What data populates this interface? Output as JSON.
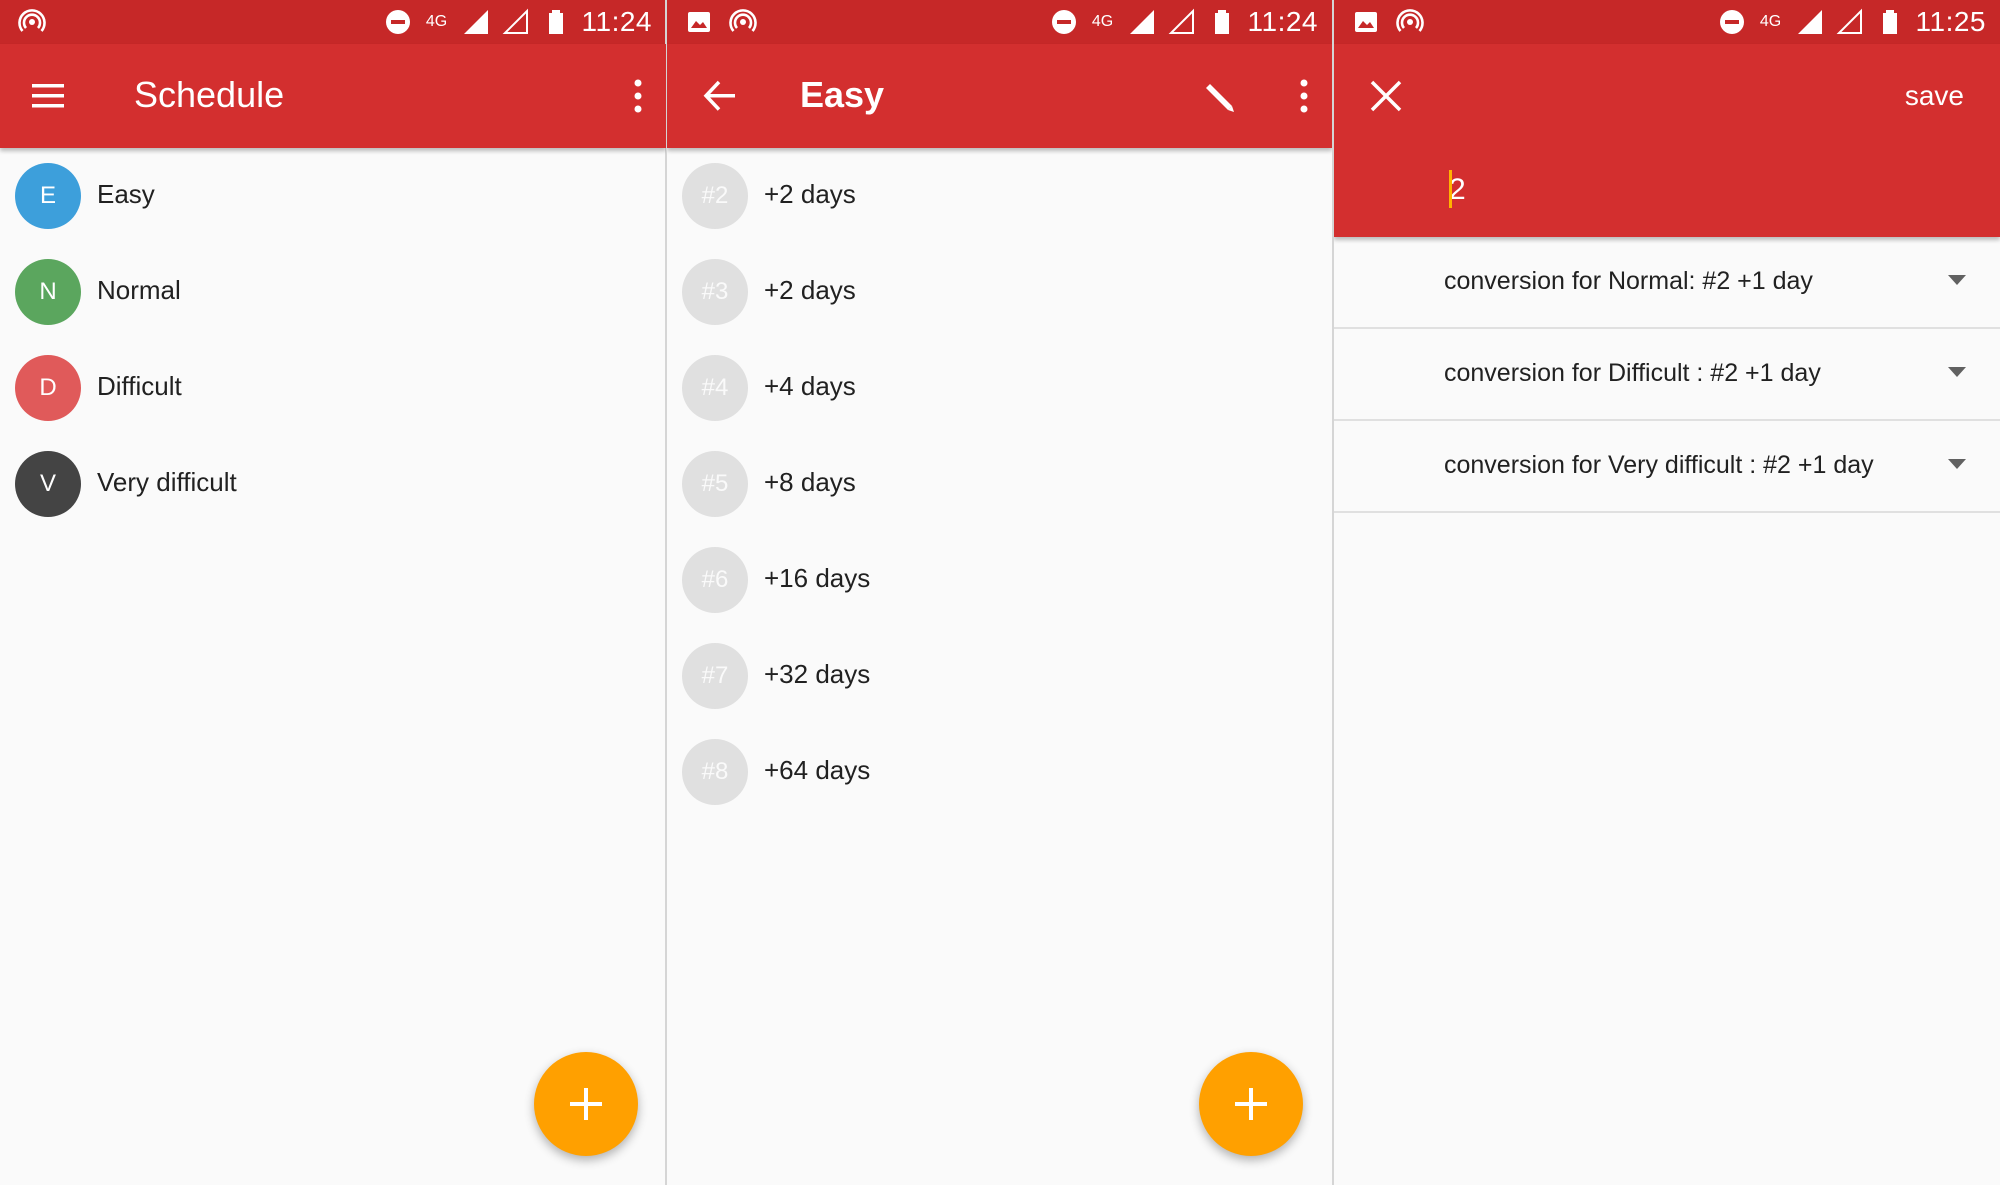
{
  "colors": {
    "primary": "#d32f2f",
    "primary_dark": "#c62828",
    "accent": "#ffa000",
    "cursor": "#ffb300"
  },
  "screens": [
    {
      "status": {
        "time": "11:24",
        "network": "4G",
        "left_icons": [
          "hotspot-icon"
        ]
      },
      "appbar": {
        "title": "Schedule",
        "nav_icon": "menu-icon",
        "action_icons": [
          "more-vert-icon"
        ]
      },
      "items": [
        {
          "initial": "E",
          "label": "Easy",
          "color": "#3d9fdb"
        },
        {
          "initial": "N",
          "label": "Normal",
          "color": "#5ba65e"
        },
        {
          "initial": "D",
          "label": "Difficult",
          "color": "#e05a5a"
        },
        {
          "initial": "V",
          "label": "Very difficult",
          "color": "#444444"
        }
      ],
      "fab": {
        "icon": "plus-icon"
      }
    },
    {
      "status": {
        "time": "11:24",
        "network": "4G",
        "left_icons": [
          "image-icon",
          "hotspot-icon"
        ]
      },
      "appbar": {
        "title": "Easy",
        "nav_icon": "arrow-back-icon",
        "action_icons": [
          "pencil-icon",
          "more-vert-icon"
        ]
      },
      "steps": [
        {
          "number": "#2",
          "interval": "+2 days"
        },
        {
          "number": "#3",
          "interval": "+2 days"
        },
        {
          "number": "#4",
          "interval": "+4 days"
        },
        {
          "number": "#5",
          "interval": "+8 days"
        },
        {
          "number": "#6",
          "interval": "+16 days"
        },
        {
          "number": "#7",
          "interval": "+32 days"
        },
        {
          "number": "#8",
          "interval": "+64 days"
        }
      ],
      "fab": {
        "icon": "plus-icon"
      }
    },
    {
      "status": {
        "time": "11:25",
        "network": "4G",
        "left_icons": [
          "image-icon",
          "hotspot-icon"
        ]
      },
      "appbar": {
        "close_icon": "close-icon",
        "save_label": "save"
      },
      "input": {
        "value": "2"
      },
      "conversions": [
        {
          "label": "conversion for Normal: #2 +1 day"
        },
        {
          "label": "conversion for Difficult : #2 +1 day"
        },
        {
          "label": "conversion for Very difficult : #2 +1 day"
        }
      ]
    }
  ]
}
